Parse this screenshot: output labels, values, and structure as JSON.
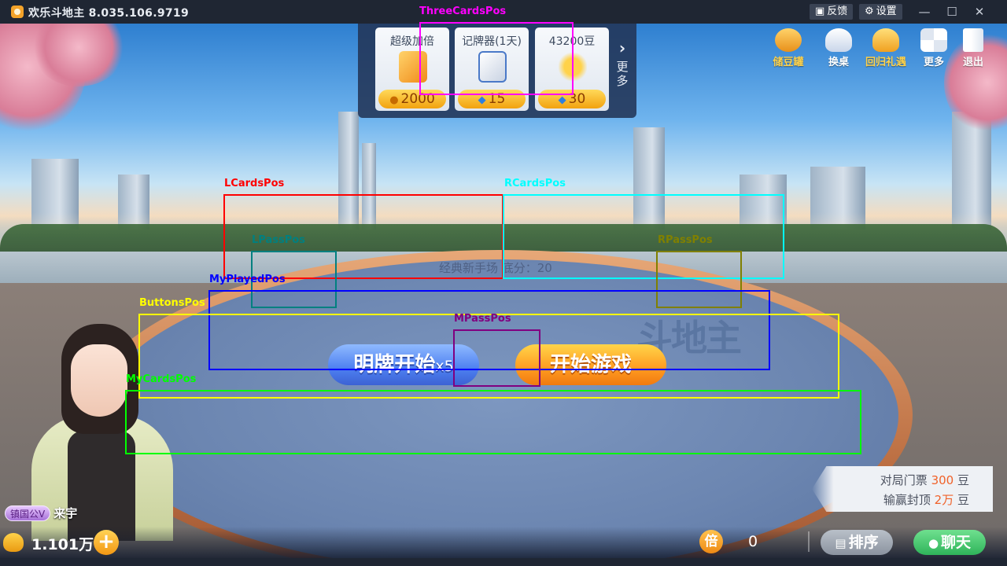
{
  "window": {
    "title": "欢乐斗地主 8.035.106.9719",
    "feedback": "反馈",
    "settings": "设置",
    "minimize": "—",
    "maximize": "☐",
    "close": "✕"
  },
  "shop": {
    "items": [
      {
        "name": "超级加倍",
        "price": "2000",
        "currency": "coin"
      },
      {
        "name": "记牌器(1天)",
        "price": "15",
        "currency": "gem"
      },
      {
        "name": "43200豆",
        "price": "30",
        "currency": "gem"
      }
    ],
    "more": "更多"
  },
  "top_right": {
    "items": [
      {
        "label": "储豆罐",
        "color": "#ffd24a"
      },
      {
        "label": "换桌",
        "color": "#ffffff"
      },
      {
        "label": "回归礼遇",
        "color": "#ffd24a"
      },
      {
        "label": "更多",
        "color": "#ffffff"
      },
      {
        "label": "退出",
        "color": "#ffffff"
      }
    ]
  },
  "table": {
    "info": "经典新手场 底分：20",
    "logo": "斗地主"
  },
  "buttons": {
    "open_cards": "明牌开始",
    "open_cards_mult": "x5",
    "start_game": "开始游戏"
  },
  "player": {
    "badge": "镇国公V",
    "name": "来宇",
    "beans": "1.101万",
    "multiplier_icon": "倍",
    "multiplier": "0"
  },
  "fee": {
    "ticket_label": "对局门票",
    "ticket_value": "300",
    "ticket_unit": "豆",
    "cap_label": "输赢封顶",
    "cap_value": "2万",
    "cap_unit": "豆"
  },
  "bottom": {
    "sort": "排序",
    "chat": "聊天"
  },
  "debug_regions": [
    {
      "label": "ThreeCardsPos",
      "color": "#ff00ff"
    },
    {
      "label": "LCardsPos",
      "color": "#ff0000"
    },
    {
      "label": "RCardsPos",
      "color": "#00ffff"
    },
    {
      "label": "LPassPos",
      "color": "#008080"
    },
    {
      "label": "RPassPos",
      "color": "#808000"
    },
    {
      "label": "MyPlayedPos",
      "color": "#0000ff"
    },
    {
      "label": "ButtonsPos",
      "color": "#ffff00"
    },
    {
      "label": "MPassPos",
      "color": "#800080"
    },
    {
      "label": "MyCardsPos",
      "color": "#00ff00"
    }
  ]
}
